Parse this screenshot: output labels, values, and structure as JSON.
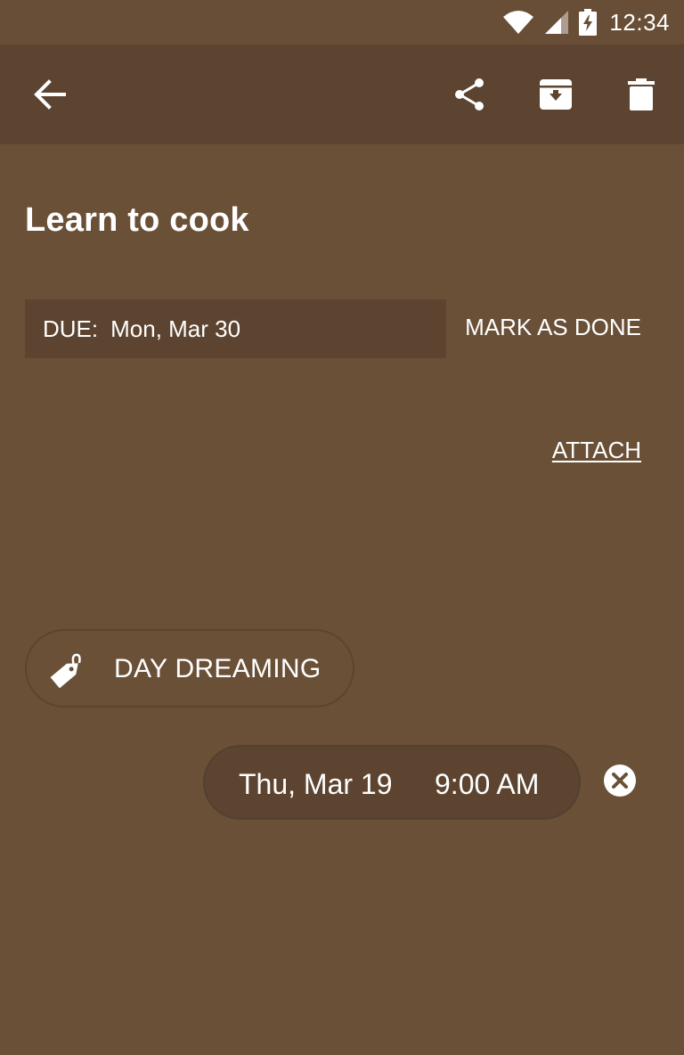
{
  "status_bar": {
    "time": "12:34",
    "icons": [
      "wifi-icon",
      "signal-icon",
      "battery-charging-icon"
    ]
  },
  "toolbar": {
    "back_icon": "arrow-back-icon",
    "actions": [
      "share-icon",
      "archive-icon",
      "delete-icon"
    ]
  },
  "task": {
    "title": "Learn to cook",
    "due_label": "DUE:",
    "due_date": "Mon, Mar 30",
    "mark_done_label": "MARK AS DONE",
    "attach_label": "ATTACH"
  },
  "tag": {
    "icon": "tag-icon",
    "label": "DAY DREAMING"
  },
  "reminder": {
    "date": "Thu, Mar 19",
    "time": "9:00 AM",
    "clear_icon": "clear-icon"
  },
  "colors": {
    "background": "#6a5037",
    "toolbar": "#5c4430",
    "text": "#ffffff"
  }
}
